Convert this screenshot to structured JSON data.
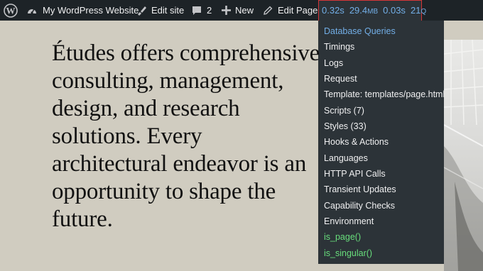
{
  "adminbar": {
    "site_name": "My WordPress Website",
    "edit_site": "Edit site",
    "comments_count": "2",
    "new_label": "New",
    "edit_page": "Edit Page",
    "qm": {
      "time": "0.32s",
      "memory": "29.4",
      "memory_unit": "MB",
      "db_time": "0.03s",
      "queries": "21",
      "queries_unit": "Q"
    }
  },
  "qm_menu": {
    "items": [
      "Database Queries",
      "Timings",
      "Logs",
      "Request",
      "Template: templates/page.html",
      "Scripts (7)",
      "Styles (33)",
      "Hooks & Actions",
      "Languages",
      "HTTP API Calls",
      "Transient Updates",
      "Capability Checks",
      "Environment",
      "is_page()",
      "is_singular()"
    ]
  },
  "content": {
    "hero": "Études offers comprehensive consulting, management, design, and research solutions. Every architectural endeavor is an opportunity to shape the future."
  },
  "colors": {
    "adminbar_bg": "#1d2327",
    "menu_bg": "#2c3338",
    "highlight_border": "#d63638",
    "link_blue": "#72aee6",
    "conditional_green": "#68de7c",
    "page_bg": "#d0ccc0"
  }
}
